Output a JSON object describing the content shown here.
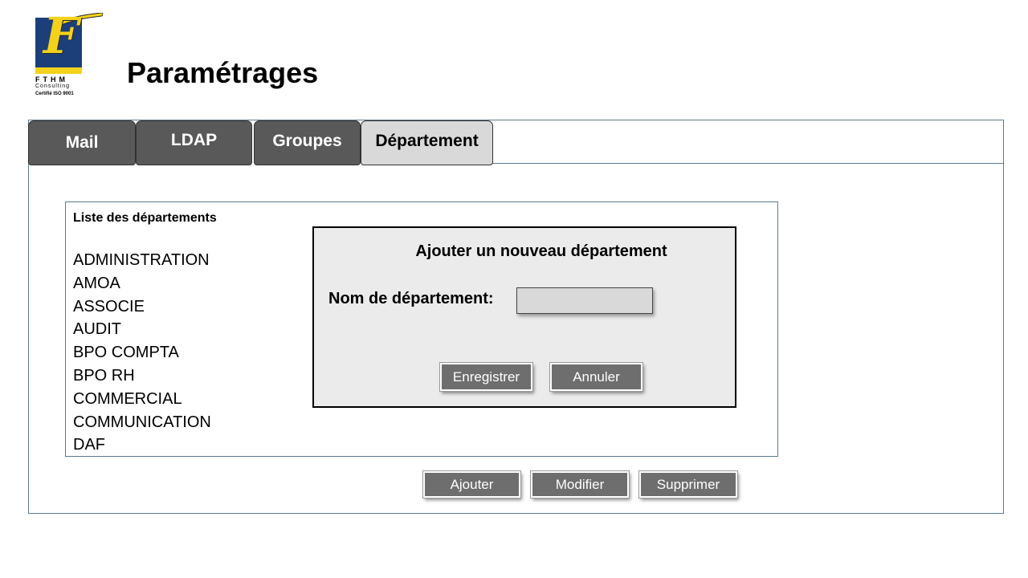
{
  "logo": {
    "letter": "F",
    "name": "FTHM",
    "subtitle": "Consulting",
    "certification": "Certifié ISO 9001"
  },
  "page": {
    "title": "Paramétrages"
  },
  "tabs": [
    {
      "label": "Mail",
      "active": false
    },
    {
      "label": "LDAP",
      "active": false
    },
    {
      "label": "Groupes",
      "active": false
    },
    {
      "label": "Département",
      "active": true
    }
  ],
  "department_list": {
    "title": "Liste des départements",
    "items": [
      "ADMINISTRATION",
      "AMOA",
      "ASSOCIE",
      "AUDIT",
      "BPO COMPTA",
      "BPO RH",
      "COMMERCIAL",
      "COMMUNICATION",
      "DAF"
    ]
  },
  "dialog": {
    "title": "Ajouter un nouveau département",
    "field_label": "Nom de département:",
    "field_value": "",
    "save_label": "Enregistrer",
    "cancel_label": "Annuler"
  },
  "actions": {
    "add_label": "Ajouter",
    "edit_label": "Modifier",
    "delete_label": "Supprimer"
  },
  "colors": {
    "logo_blue": "#1c3f7a",
    "logo_yellow": "#f4d21b",
    "tab_inactive": "#595959",
    "tab_active": "#d9d9d9",
    "button": "#6e6e6e",
    "panel_border": "#5a7a91"
  }
}
